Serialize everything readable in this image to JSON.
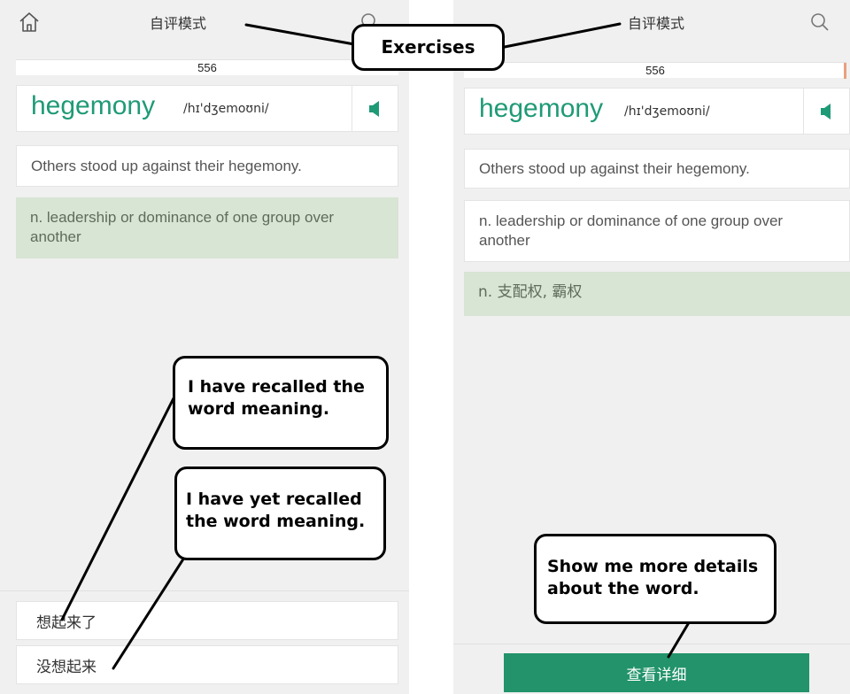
{
  "left": {
    "header_title": "自评模式",
    "progress": "556",
    "word": "hegemony",
    "phonetic": "/hɪ'dʒemoʊni/",
    "example": "Others stood up against their hegemony.",
    "definition": "n. leadership or dominance of one group over another",
    "option_remembered": "想起来了",
    "option_forgot": "没想起来"
  },
  "right": {
    "header_title": "自评模式",
    "progress": "556",
    "word": "hegemony",
    "phonetic": "/hɪ'dʒemoʊni/",
    "example": "Others stood up against their hegemony.",
    "definition": "n. leadership or dominance of one group over another",
    "translation": "n. 支配权, 霸权",
    "detail_button": "查看详细"
  },
  "annotations": {
    "exercises": "Exercises",
    "recalled": "I have recalled the word meaning.",
    "not_recalled": "I have yet recalled the word meaning.",
    "details": "Show me more details about the word."
  },
  "colors": {
    "accent_green": "#22936b",
    "word_green": "#1f9a76",
    "definition_bg": "#d8e4d4"
  },
  "icons": [
    "home-icon",
    "search-icon",
    "speaker-icon"
  ]
}
